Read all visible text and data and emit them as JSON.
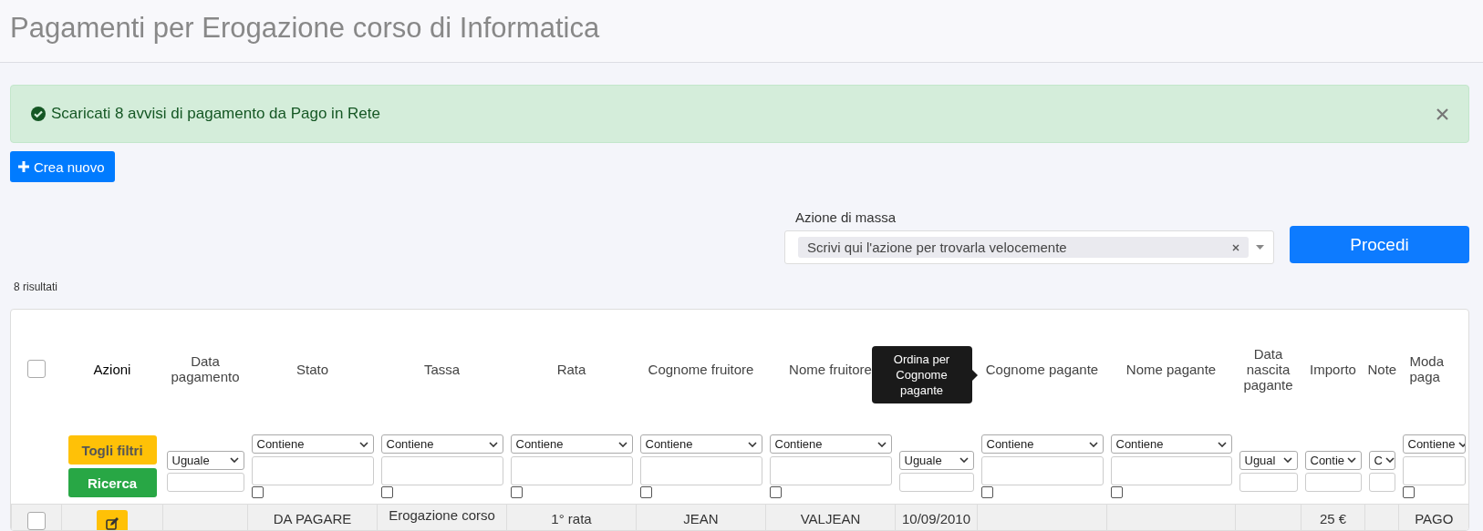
{
  "page": {
    "title": "Pagamenti per Erogazione corso di Informatica"
  },
  "alert": {
    "kind": "success",
    "message": "Scaricati 8 avvisi di pagamento da Pago in Rete"
  },
  "create_button": "Crea nuovo",
  "mass_action": {
    "label": "Azione di massa",
    "selected": "Scrivi qui l'azione per trovarla velocemente",
    "button": "Procedi"
  },
  "result_count": "8 risultati",
  "table": {
    "select_all_checked": false,
    "actions_header": "Azioni",
    "toggle_filters": "Togli filtri",
    "search_button": "Ricerca",
    "columns": [
      {
        "label": "Data pagamento",
        "operator": "Uguale"
      },
      {
        "label": "Stato",
        "operator": "Contiene",
        "null_check": false
      },
      {
        "label": "Tassa",
        "operator": "Contiene",
        "null_check": false
      },
      {
        "label": "Rata",
        "operator": "Contiene",
        "null_check": false
      },
      {
        "label": "Cognome fruitore",
        "operator": "Contiene",
        "null_check": false
      },
      {
        "label": "Nome fruitore",
        "operator": "Contiene",
        "null_check": false
      },
      {
        "operator": "Uguale"
      },
      {
        "label": "Cognome pagante",
        "operator": "Contiene",
        "null_check": false,
        "tooltip": "Ordina per Cognome pagante"
      },
      {
        "label": "Nome pagante",
        "operator": "Contiene",
        "null_check": false
      },
      {
        "label": "Data nascita pagante",
        "operator": "Ugual"
      },
      {
        "label": "Importo",
        "operator": "Contie"
      },
      {
        "label": "Note",
        "operator": "C"
      },
      {
        "label": "Moda paga",
        "operator": "Contiene",
        "null_check": false
      }
    ],
    "rows": [
      {
        "checked": false,
        "cells": [
          null,
          "DA PAGARE",
          "Erogazione corso",
          "1° rata",
          "JEAN",
          "VALJEAN",
          "10/09/2010",
          null,
          null,
          null,
          "25 €",
          null,
          "PAGO"
        ]
      }
    ]
  }
}
